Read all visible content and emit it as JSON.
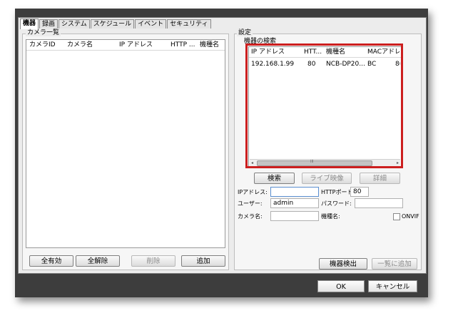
{
  "tabs": [
    "機器",
    "録画",
    "システム",
    "スケジュール",
    "イベント",
    "セキュリティ"
  ],
  "camera_list": {
    "group_label": "カメラ一覧",
    "columns": [
      "カメラID",
      "カメラ名",
      "IP アドレス",
      "HTTP ...",
      "機種名"
    ],
    "buttons": {
      "enable_all": "全有効",
      "release_all": "全解除",
      "delete": "削除",
      "add": "追加"
    }
  },
  "settings": {
    "group_label": "設定",
    "search_group_label": "機器の検索",
    "search_columns": [
      "IP アドレス",
      "HTT...",
      "機種名",
      "MACアドレス"
    ],
    "search_results": [
      {
        "ip": "192.168.1.99",
        "http": "80",
        "model": "NCB-DP20...",
        "mac": "BC",
        "extra": "8("
      }
    ],
    "buttons": {
      "search": "検索",
      "live": "ライブ映像",
      "detail": "詳細",
      "detect": "機器検出",
      "add_to_list": "一覧に追加"
    },
    "labels": {
      "ip": "IPアドレス:",
      "http_port": "HTTPポート:",
      "user": "ユーザー:",
      "password": "パスワード:",
      "camera_name": "カメラ名:",
      "model": "機種名:",
      "onvif": "ONVIF"
    },
    "values": {
      "ip": "",
      "http_port": "80",
      "user": "admin",
      "password": "",
      "camera_name": ""
    }
  },
  "footer": {
    "ok": "OK",
    "cancel": "キャンセル"
  },
  "colors": {
    "highlight": "#cc1f1f",
    "window_frame": "#3d3d3d"
  }
}
